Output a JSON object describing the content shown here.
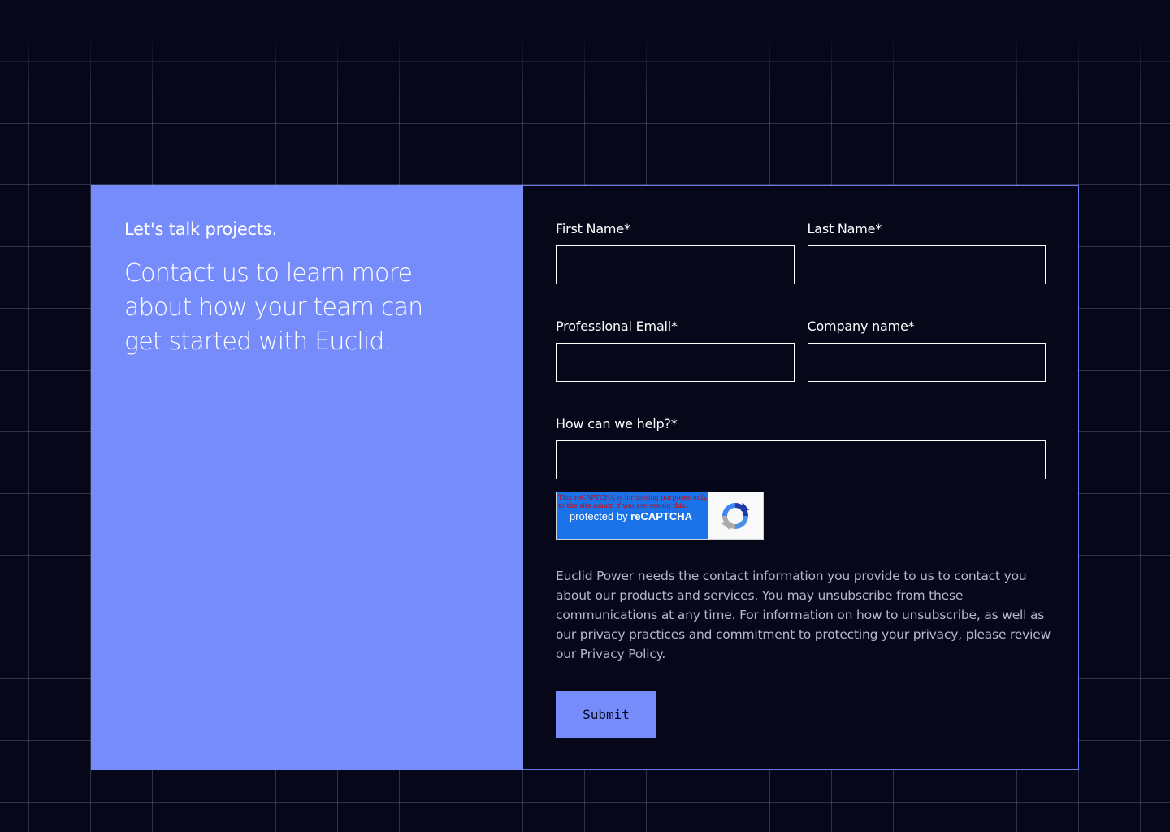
{
  "intro": {
    "eyebrow": "Let's talk projects.",
    "headline": "Contact us to learn more about how your team can get started with Euclid."
  },
  "form": {
    "first_name_label": "First Name*",
    "last_name_label": "Last Name*",
    "email_label": "Professional Email*",
    "company_label": "Company name*",
    "help_label": "How can we help?*",
    "first_name_value": "",
    "last_name_value": "",
    "email_value": "",
    "company_value": "",
    "help_value": ""
  },
  "recaptcha": {
    "warning": "This reCAPTCHA is for testing purposes only. Please report to the site admin if you are seeing this.",
    "protected_by": "protected by ",
    "brand": "reCAPTCHA",
    "icon": "recaptcha-logo-icon"
  },
  "disclaimer": "Euclid Power needs the contact information you provide to us to contact you about our products and services. You may unsubscribe from these communications at any time. For information on how to unsubscribe, as well as our privacy practices and commitment to protecting your privacy, please review our Privacy Policy.",
  "submit_label": "Submit",
  "colors": {
    "background": "#06081a",
    "accent": "#778cfb",
    "border": "#6677e6",
    "recaptcha_blue": "#1a73e8"
  }
}
